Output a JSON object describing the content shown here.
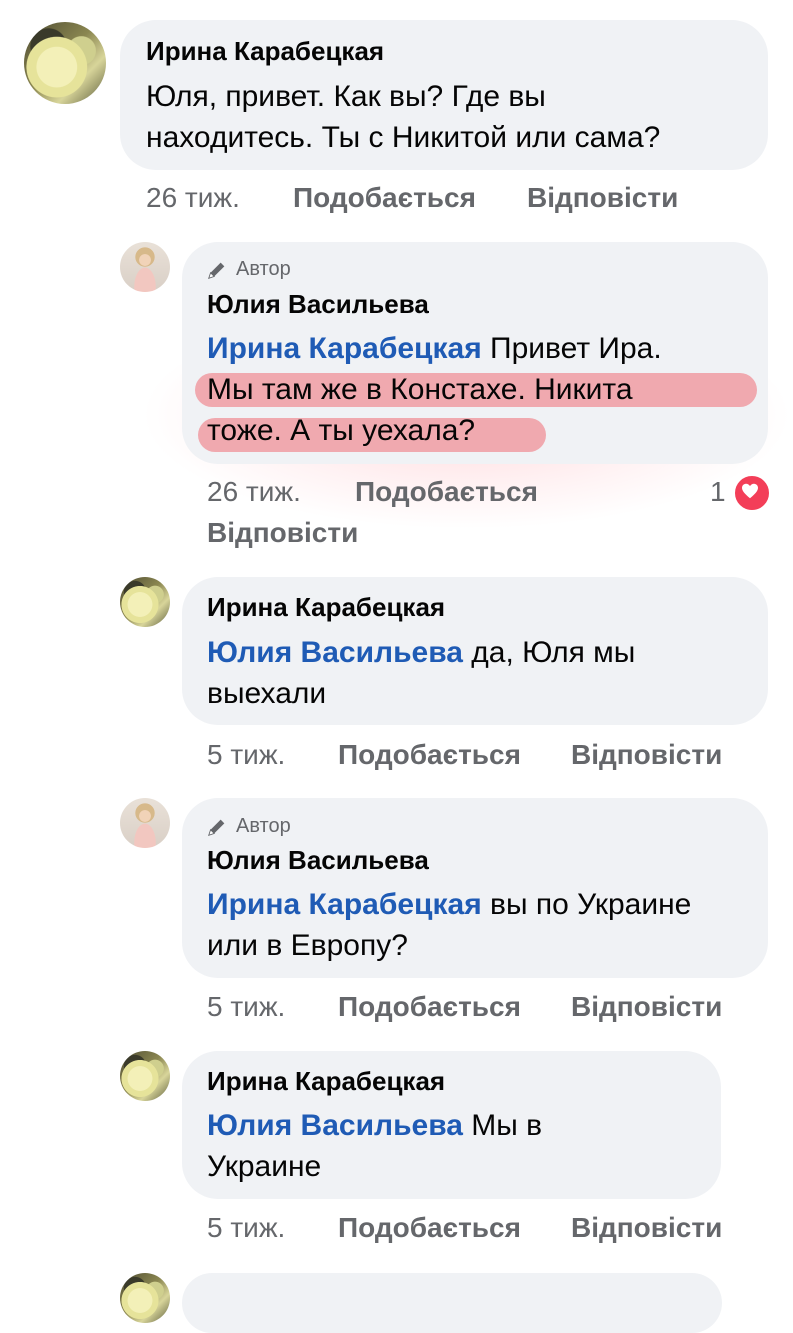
{
  "comments": [
    {
      "avatar": "flower-avatar",
      "name": "Ирина Карабецкая",
      "lines": [
        "Юля, привет. Как вы? Где вы",
        "находитесь. Ты с Никитой или сама?"
      ],
      "time": "26 тиж.",
      "like": "Подобається",
      "reply": "Відповісти"
    },
    {
      "avatar": "person-avatar",
      "author_tag": "Автор",
      "name": "Юлия Васильева",
      "mention": "Ирина Карабецкая",
      "first_line_rest": " Привет Ира.",
      "lines": [
        "Мы там же в Констахе. Никита",
        "тоже. А ты уехала?"
      ],
      "time": "26 тиж.",
      "like": "Подобається",
      "reply": "Відповісти",
      "reaction_count": "1",
      "reaction_icon": "heart-icon"
    },
    {
      "avatar": "flower-avatar",
      "name": "Ирина Карабецкая",
      "mention": "Юлия Васильева",
      "first_line_rest": " да, Юля мы",
      "lines": [
        "выехали"
      ],
      "time": "5 тиж.",
      "like": "Подобається",
      "reply": "Відповісти"
    },
    {
      "avatar": "person-avatar",
      "author_tag": "Автор",
      "name": "Юлия Васильева",
      "mention": "Ирина Карабецкая",
      "first_line_rest": " вы по Украине",
      "lines": [
        "или в Европу?"
      ],
      "time": "5 тиж.",
      "like": "Подобається",
      "reply": "Відповісти"
    },
    {
      "avatar": "flower-avatar",
      "name": "Ирина Карабецкая",
      "mention": "Юлия Васильева",
      "first_line_rest": " Мы в",
      "lines": [
        "Украине"
      ],
      "time": "5 тиж.",
      "like": "Подобається",
      "reply": "Відповісти"
    }
  ],
  "colors": {
    "bubble": "#f0f2f5",
    "mention": "#1f5bb5",
    "meta": "#65676b",
    "highlight": "#f0505a",
    "heart": "#f33e58"
  }
}
